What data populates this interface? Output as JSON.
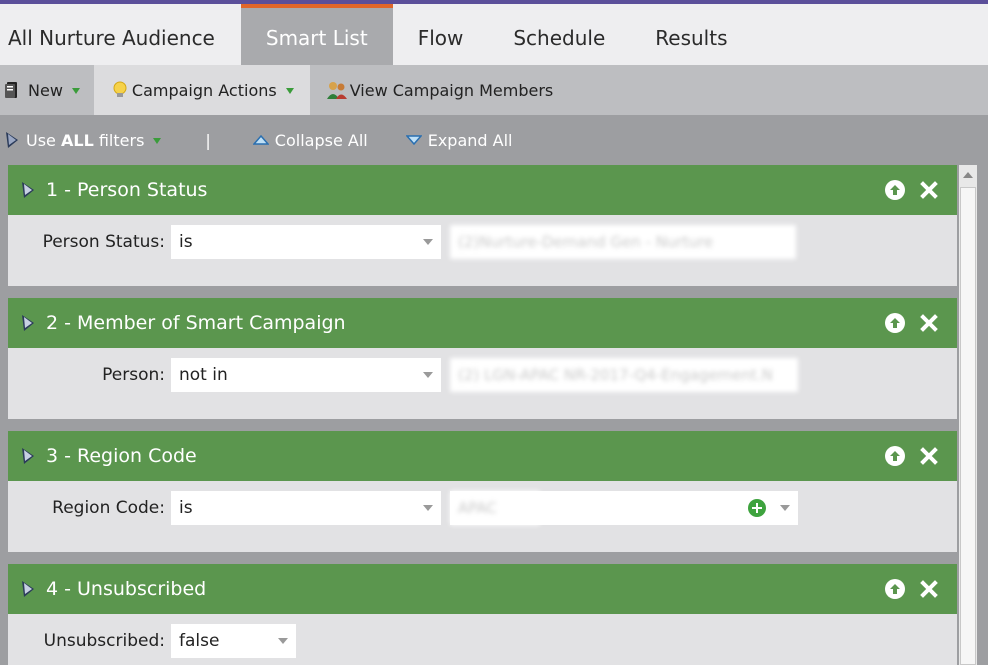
{
  "tabs": [
    {
      "label": "All Nurture Audience"
    },
    {
      "label": "Smart List",
      "active": true
    },
    {
      "label": "Flow"
    },
    {
      "label": "Schedule"
    },
    {
      "label": "Results"
    }
  ],
  "toolbar": {
    "new_label": "New",
    "campaign_actions_label": "Campaign Actions",
    "view_members_label": "View Campaign Members"
  },
  "filterbar": {
    "use_prefix": "Use ",
    "use_strong": "ALL",
    "use_suffix": " filters",
    "separator": "|",
    "collapse_label": "Collapse All",
    "expand_label": "Expand All"
  },
  "filters": [
    {
      "title": "1 - Person Status",
      "field_label": "Person Status:",
      "operator": "is",
      "value": "(2)Nurture-Demand Gen - Nurture"
    },
    {
      "title": "2 - Member of Smart Campaign",
      "field_label": "Person:",
      "operator": "not in",
      "value": "(2) LGN-APAC NR-2017-Q4-Engagement.N"
    },
    {
      "title": "3 - Region Code",
      "field_label": "Region Code:",
      "operator": "is",
      "value": "APAC"
    },
    {
      "title": "4 - Unsubscribed",
      "field_label": "Unsubscribed:",
      "operator": "false"
    }
  ],
  "colors": {
    "accent_tab": "#e0662a",
    "header_green": "#5b964e",
    "top_line": "#5b4f9a"
  }
}
